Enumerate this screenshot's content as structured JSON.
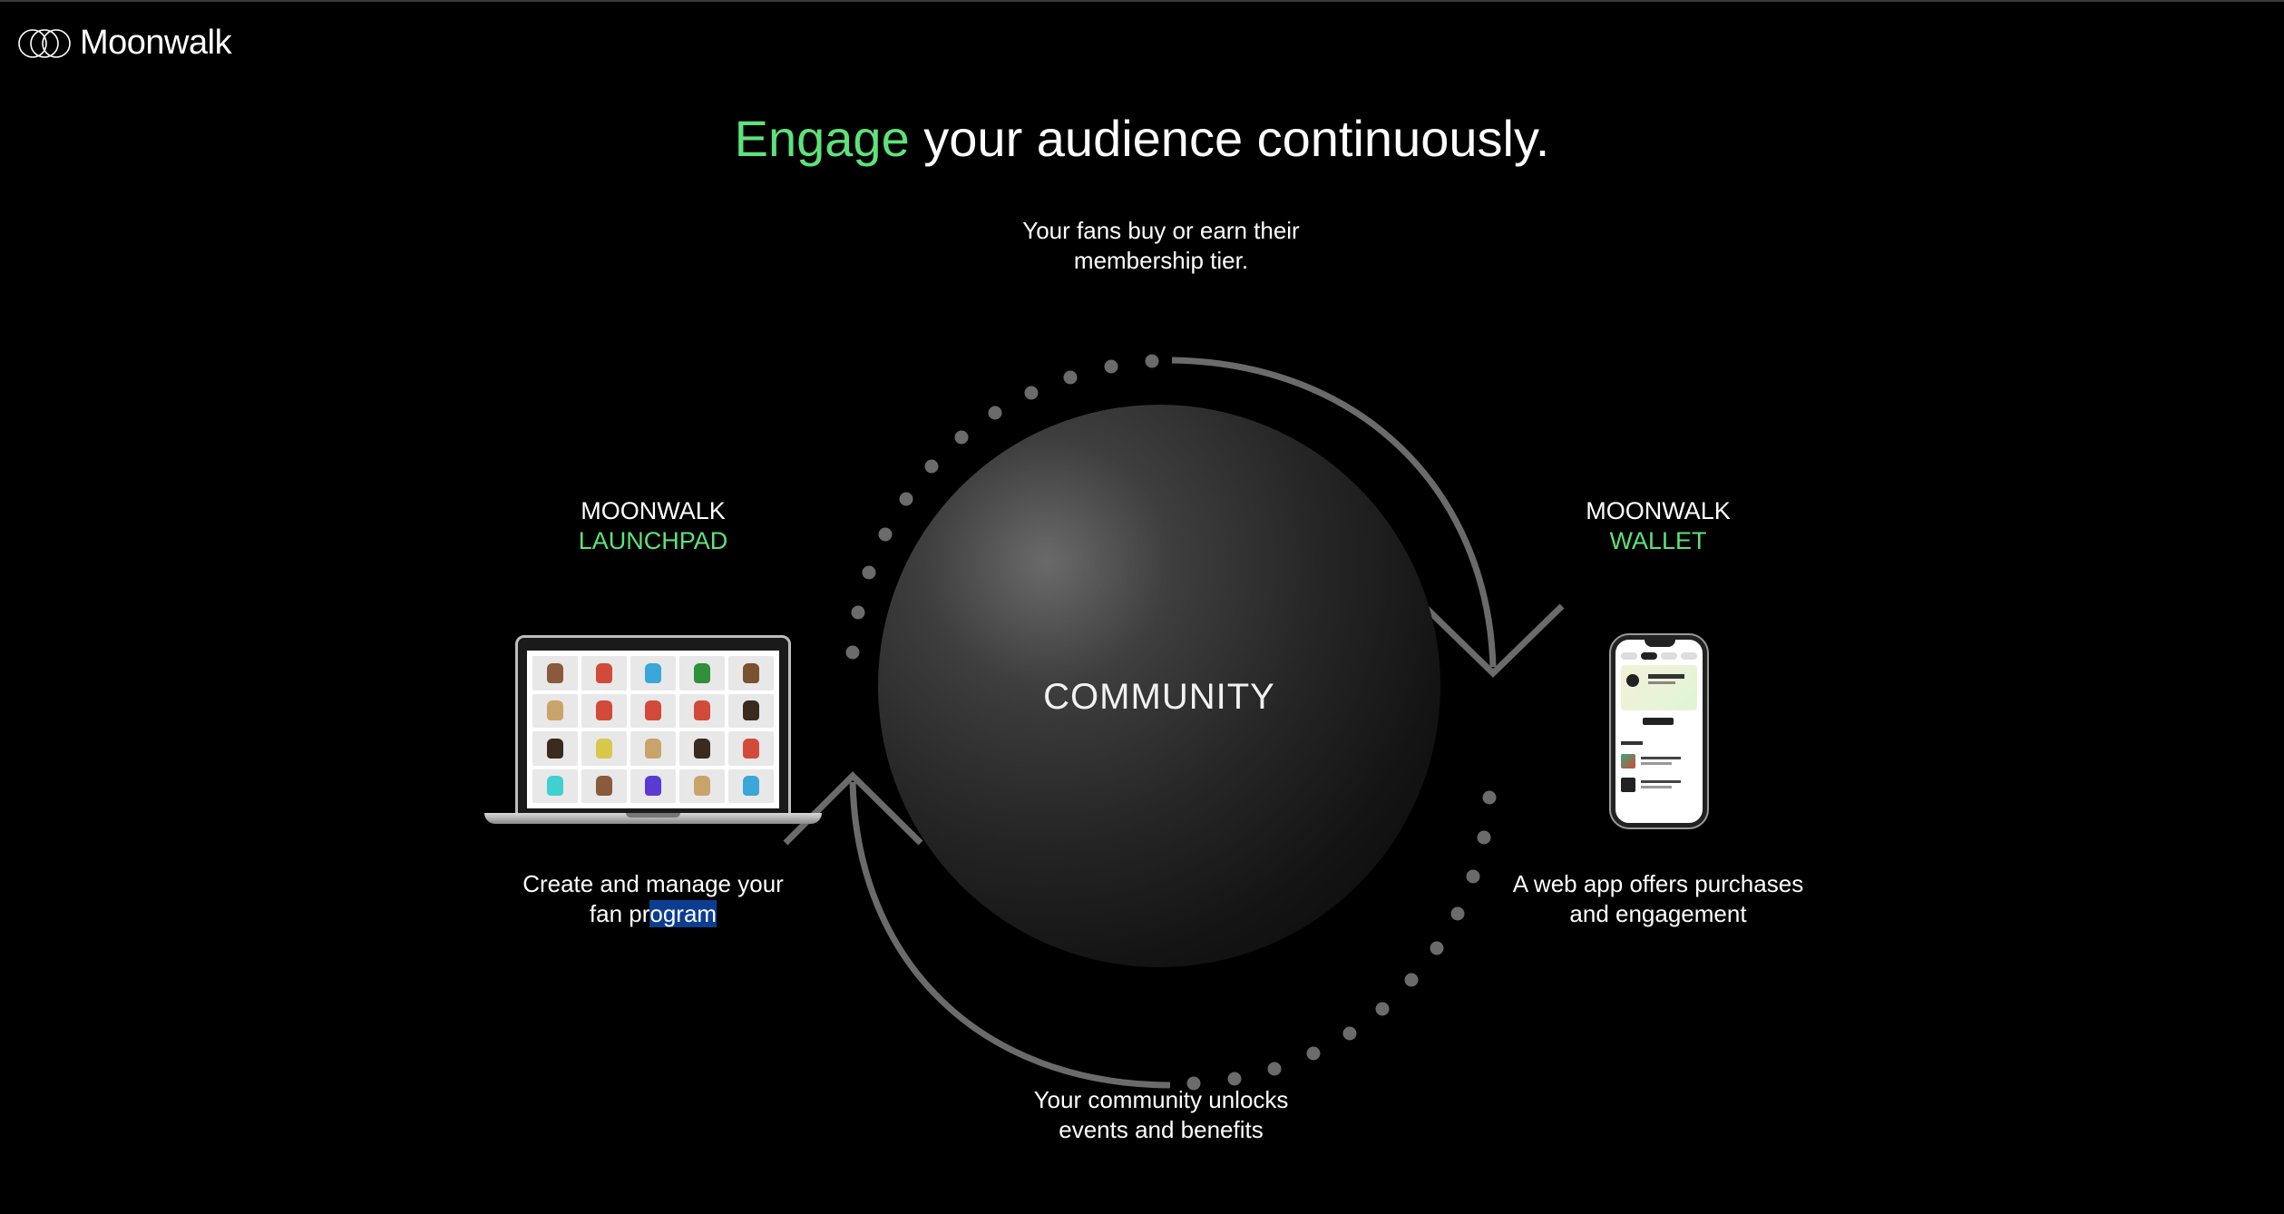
{
  "brand": {
    "name": "Moonwalk",
    "logo_icon": "overlapping-circles-logo"
  },
  "headline": {
    "accent": "Engage",
    "rest": "your audience continuously."
  },
  "diagram": {
    "center_label": "COMMUNITY",
    "top_caption": {
      "line1": "Your fans buy or earn their",
      "line2": "membership tier."
    },
    "bottom_caption": {
      "line1": "Your community unlocks",
      "line2": "events and benefits"
    }
  },
  "launchpad": {
    "label_main": "MOONWALK",
    "label_accent": "LAUNCHPAD",
    "caption_line1": "Create and manage your",
    "caption_line2_pre": "fan pr",
    "caption_line2_selected": "ogram",
    "avatar_colors": [
      "#8a5a3c",
      "#d24a3a",
      "#3aa7d9",
      "#2f8f3a",
      "#7a5230",
      "#c9a46a",
      "#d24a3a",
      "#d24a3a",
      "#d24a3a",
      "#3b2a1e",
      "#3b2a1e",
      "#d8c84a",
      "#c9a46a",
      "#3b2a1e",
      "#d24a3a",
      "#3fd0d0",
      "#8a5a3c",
      "#5a3ad2",
      "#c9a46a",
      "#3aa7d9"
    ]
  },
  "wallet": {
    "label_main": "MOONWALK",
    "label_accent": "WALLET",
    "caption_line1": "A web app offers purchases",
    "caption_line2": "and engagement"
  },
  "colors": {
    "accent": "#5ee27a",
    "background": "#000000",
    "arrow": "#6b6b6b"
  }
}
